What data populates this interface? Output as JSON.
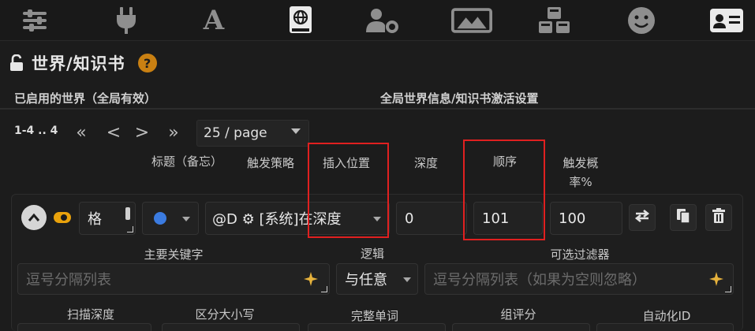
{
  "topbar": {
    "icons": [
      "sliders-icon",
      "plug-icon",
      "font-icon",
      "book-globe-icon",
      "user-gear-icon",
      "image-icon",
      "cubes-icon",
      "smiley-icon",
      "id-card-icon"
    ],
    "active": "book-globe-icon",
    "font_glyph": "A"
  },
  "header": {
    "title": "世界/知识书",
    "help_glyph": "?"
  },
  "sections": {
    "active_worlds_label": "已启用的世界（全局有效）",
    "global_settings_label": "全局世界信息/知识书激活设置"
  },
  "pager": {
    "range": "1-4 .. 4",
    "first": "«",
    "prev": "<",
    "next": ">",
    "last": "»",
    "per_page": "25 / page"
  },
  "columns": {
    "title": "标题（备忘）",
    "trigger_strategy": "触发策略",
    "insert_position": "插入位置",
    "depth": "深度",
    "order": "顺序",
    "trigger_prob_line1": "触发概",
    "trigger_prob_line2": "率%"
  },
  "entry": {
    "title_value": "格",
    "strategy_color": "#3b7be0",
    "position_value": "@D ⚙ [系统]在深度",
    "depth_value": "0",
    "order_value": "101",
    "probability_value": "100",
    "keywords_label": "主要关键字",
    "keywords_placeholder": "逗号分隔列表",
    "logic_label": "逻辑",
    "logic_value": "与任意",
    "filter_label": "可选过滤器",
    "filter_placeholder": "逗号分隔列表（如果为空则忽略）",
    "scan_depth_label": "扫描深度",
    "case_sensitive_label": "区分大小写",
    "whole_words_label": "完整单词",
    "group_scoring_label": "组评分",
    "automation_id_label": "自动化ID"
  },
  "colors": {
    "accent": "#e9a20c",
    "highlight": "#e02020",
    "help": "#c98012"
  }
}
